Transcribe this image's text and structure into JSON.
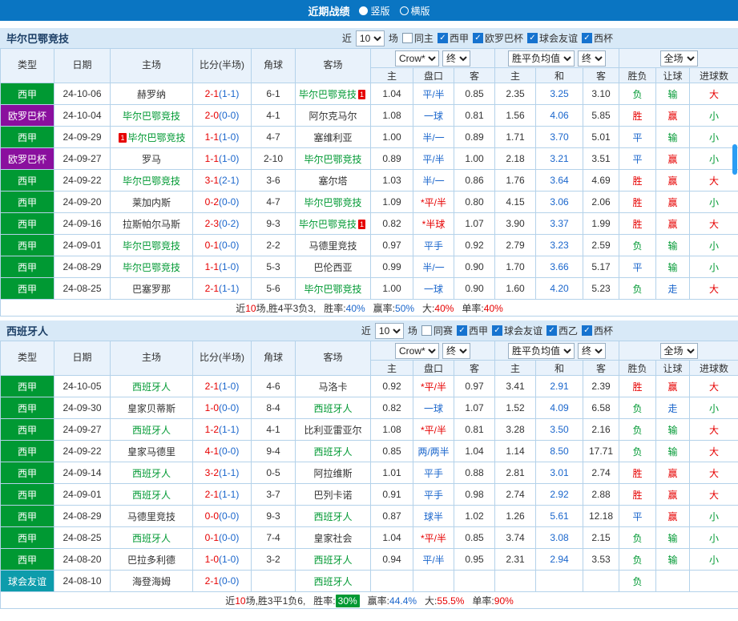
{
  "topbar": {
    "title": "近期战绩",
    "options": [
      {
        "label": "竖版",
        "selected": true
      },
      {
        "label": "横版",
        "selected": false
      }
    ]
  },
  "filter_text": {
    "near": "近",
    "games": "场"
  },
  "selects": {
    "company": "Crow*",
    "period": "终",
    "avg": "胜平负均值",
    "scope": "全场"
  },
  "columns": {
    "type": "类型",
    "date": "日期",
    "home": "主场",
    "score": "比分(半场)",
    "corner": "角球",
    "away": "客场",
    "o_home": "主",
    "o_line": "盘口",
    "o_away": "客",
    "e_home": "主",
    "e_draw": "和",
    "e_away": "客",
    "result": "胜负",
    "handicap": "让球",
    "goals": "进球数"
  },
  "type_colors": {
    "西甲": "#009933",
    "欧罗巴杯": "#8a0f9e",
    "球会友谊": "#0d9cab"
  },
  "sections": [
    {
      "team": "毕尔巴鄂竞技",
      "count": "10",
      "checkboxes": [
        {
          "label": "同主",
          "checked": false
        },
        {
          "label": "西甲",
          "checked": true
        },
        {
          "label": "欧罗巴杯",
          "checked": true
        },
        {
          "label": "球会友谊",
          "checked": true
        },
        {
          "label": "西杯",
          "checked": true
        }
      ],
      "rows": [
        {
          "type": "西甲",
          "date": "24-10-06",
          "home": "赫罗纳",
          "score": "2-1",
          "half": "(1-1)",
          "corner": "6-1",
          "away": "毕尔巴鄂竞技",
          "away_focus": true,
          "away_card": 1,
          "crow_home": "1.04",
          "line": "平/半",
          "crow_away": "0.85",
          "avg_home": "2.35",
          "avg_draw": "3.25",
          "avg_away": "3.10",
          "result": "负",
          "handicap": "输",
          "goals": "大"
        },
        {
          "type": "欧罗巴杯",
          "date": "24-10-04",
          "home": "毕尔巴鄂竞技",
          "home_focus": true,
          "score": "2-0",
          "half": "(0-0)",
          "corner": "4-1",
          "away": "阿尔克马尔",
          "crow_home": "1.08",
          "line": "一球",
          "crow_away": "0.81",
          "avg_home": "1.56",
          "avg_draw": "4.06",
          "avg_away": "5.85",
          "result": "胜",
          "handicap": "赢",
          "goals": "小"
        },
        {
          "type": "西甲",
          "date": "24-09-29",
          "home": "毕尔巴鄂竞技",
          "home_focus": true,
          "home_card": 1,
          "card_left": true,
          "score": "1-1",
          "half": "(1-0)",
          "corner": "4-7",
          "away": "塞维利亚",
          "crow_home": "1.00",
          "line": "半/一",
          "crow_away": "0.89",
          "avg_home": "1.71",
          "avg_draw": "3.70",
          "avg_away": "5.01",
          "result": "平",
          "handicap": "输",
          "goals": "小"
        },
        {
          "type": "欧罗巴杯",
          "date": "24-09-27",
          "home": "罗马",
          "score": "1-1",
          "half": "(1-0)",
          "corner": "2-10",
          "away": "毕尔巴鄂竞技",
          "away_focus": true,
          "crow_home": "0.89",
          "line": "平/半",
          "crow_away": "1.00",
          "avg_home": "2.18",
          "avg_draw": "3.21",
          "avg_away": "3.51",
          "result": "平",
          "handicap": "赢",
          "goals": "小"
        },
        {
          "type": "西甲",
          "date": "24-09-22",
          "home": "毕尔巴鄂竞技",
          "home_focus": true,
          "score": "3-1",
          "half": "(2-1)",
          "corner": "3-6",
          "away": "塞尔塔",
          "crow_home": "1.03",
          "line": "半/一",
          "crow_away": "0.86",
          "avg_home": "1.76",
          "avg_draw": "3.64",
          "avg_away": "4.69",
          "result": "胜",
          "handicap": "赢",
          "goals": "大"
        },
        {
          "type": "西甲",
          "date": "24-09-20",
          "home": "莱加内斯",
          "score": "0-2",
          "half": "(0-0)",
          "corner": "4-7",
          "away": "毕尔巴鄂竞技",
          "away_focus": true,
          "crow_home": "1.09",
          "line": "*平/半",
          "crow_away": "0.80",
          "avg_home": "4.15",
          "avg_draw": "3.06",
          "avg_away": "2.06",
          "result": "胜",
          "handicap": "赢",
          "goals": "小"
        },
        {
          "type": "西甲",
          "date": "24-09-16",
          "home": "拉斯帕尔马斯",
          "score": "2-3",
          "half": "(0-2)",
          "corner": "9-3",
          "away": "毕尔巴鄂竞技",
          "away_focus": true,
          "away_card": 1,
          "crow_home": "0.82",
          "line": "*半球",
          "crow_away": "1.07",
          "avg_home": "3.90",
          "avg_draw": "3.37",
          "avg_away": "1.99",
          "result": "胜",
          "handicap": "赢",
          "goals": "大"
        },
        {
          "type": "西甲",
          "date": "24-09-01",
          "home": "毕尔巴鄂竞技",
          "home_focus": true,
          "score": "0-1",
          "half": "(0-0)",
          "corner": "2-2",
          "away": "马德里竞技",
          "crow_home": "0.97",
          "line": "平手",
          "crow_away": "0.92",
          "avg_home": "2.79",
          "avg_draw": "3.23",
          "avg_away": "2.59",
          "result": "负",
          "handicap": "输",
          "goals": "小"
        },
        {
          "type": "西甲",
          "date": "24-08-29",
          "home": "毕尔巴鄂竞技",
          "home_focus": true,
          "score": "1-1",
          "half": "(1-0)",
          "corner": "5-3",
          "away": "巴伦西亚",
          "crow_home": "0.99",
          "line": "半/一",
          "crow_away": "0.90",
          "avg_home": "1.70",
          "avg_draw": "3.66",
          "avg_away": "5.17",
          "result": "平",
          "handicap": "输",
          "goals": "小"
        },
        {
          "type": "西甲",
          "date": "24-08-25",
          "home": "巴塞罗那",
          "score": "2-1",
          "half": "(1-1)",
          "corner": "5-6",
          "away": "毕尔巴鄂竞技",
          "away_focus": true,
          "crow_home": "1.00",
          "line": "一球",
          "crow_away": "0.90",
          "avg_home": "1.60",
          "avg_draw": "4.20",
          "avg_away": "5.23",
          "result": "负",
          "handicap": "走",
          "goals": "大"
        }
      ],
      "summary": {
        "lead": "近",
        "count": "10",
        "tail": "场,胜4平3负3,",
        "win_label": "胜率:",
        "win": "40%",
        "win_badge": false,
        "ah_label": "赢率:",
        "ah": "50%",
        "big_label": "大:",
        "big": "40%",
        "odd_label": "单率:",
        "odd": "40%"
      }
    },
    {
      "team": "西班牙人",
      "count": "10",
      "checkboxes": [
        {
          "label": "同赛",
          "checked": false
        },
        {
          "label": "西甲",
          "checked": true
        },
        {
          "label": "球会友谊",
          "checked": true
        },
        {
          "label": "西乙",
          "checked": true
        },
        {
          "label": "西杯",
          "checked": true
        }
      ],
      "rows": [
        {
          "type": "西甲",
          "date": "24-10-05",
          "home": "西班牙人",
          "home_focus": true,
          "score": "2-1",
          "half": "(1-0)",
          "corner": "4-6",
          "away": "马洛卡",
          "crow_home": "0.92",
          "line": "*平/半",
          "crow_away": "0.97",
          "avg_home": "3.41",
          "avg_draw": "2.91",
          "avg_away": "2.39",
          "result": "胜",
          "handicap": "赢",
          "goals": "大"
        },
        {
          "type": "西甲",
          "date": "24-09-30",
          "home": "皇家贝蒂斯",
          "score": "1-0",
          "half": "(0-0)",
          "corner": "8-4",
          "away": "西班牙人",
          "away_focus": true,
          "crow_home": "0.82",
          "line": "一球",
          "crow_away": "1.07",
          "avg_home": "1.52",
          "avg_draw": "4.09",
          "avg_away": "6.58",
          "result": "负",
          "handicap": "走",
          "goals": "小"
        },
        {
          "type": "西甲",
          "date": "24-09-27",
          "home": "西班牙人",
          "home_focus": true,
          "score": "1-2",
          "half": "(1-1)",
          "corner": "4-1",
          "away": "比利亚雷亚尔",
          "crow_home": "1.08",
          "line": "*平/半",
          "crow_away": "0.81",
          "avg_home": "3.28",
          "avg_draw": "3.50",
          "avg_away": "2.16",
          "result": "负",
          "handicap": "输",
          "goals": "大"
        },
        {
          "type": "西甲",
          "date": "24-09-22",
          "home": "皇家马德里",
          "score": "4-1",
          "half": "(0-0)",
          "corner": "9-4",
          "away": "西班牙人",
          "away_focus": true,
          "crow_home": "0.85",
          "line": "两/两半",
          "crow_away": "1.04",
          "avg_home": "1.14",
          "avg_draw": "8.50",
          "avg_away": "17.71",
          "result": "负",
          "handicap": "输",
          "goals": "大"
        },
        {
          "type": "西甲",
          "date": "24-09-14",
          "home": "西班牙人",
          "home_focus": true,
          "score": "3-2",
          "half": "(1-1)",
          "corner": "0-5",
          "away": "阿拉维斯",
          "crow_home": "1.01",
          "line": "平手",
          "crow_away": "0.88",
          "avg_home": "2.81",
          "avg_draw": "3.01",
          "avg_away": "2.74",
          "result": "胜",
          "handicap": "赢",
          "goals": "大"
        },
        {
          "type": "西甲",
          "date": "24-09-01",
          "home": "西班牙人",
          "home_focus": true,
          "score": "2-1",
          "half": "(1-1)",
          "corner": "3-7",
          "away": "巴列卡诺",
          "crow_home": "0.91",
          "line": "平手",
          "crow_away": "0.98",
          "avg_home": "2.74",
          "avg_draw": "2.92",
          "avg_away": "2.88",
          "result": "胜",
          "handicap": "赢",
          "goals": "大"
        },
        {
          "type": "西甲",
          "date": "24-08-29",
          "home": "马德里竞技",
          "score": "0-0",
          "half": "(0-0)",
          "corner": "9-3",
          "away": "西班牙人",
          "away_focus": true,
          "crow_home": "0.87",
          "line": "球半",
          "crow_away": "1.02",
          "avg_home": "1.26",
          "avg_draw": "5.61",
          "avg_away": "12.18",
          "result": "平",
          "handicap": "赢",
          "goals": "小"
        },
        {
          "type": "西甲",
          "date": "24-08-25",
          "home": "西班牙人",
          "home_focus": true,
          "score": "0-1",
          "half": "(0-0)",
          "corner": "7-4",
          "away": "皇家社会",
          "crow_home": "1.04",
          "line": "*平/半",
          "crow_away": "0.85",
          "avg_home": "3.74",
          "avg_draw": "3.08",
          "avg_away": "2.15",
          "result": "负",
          "handicap": "输",
          "goals": "小"
        },
        {
          "type": "西甲",
          "date": "24-08-20",
          "home": "巴拉多利德",
          "score": "1-0",
          "half": "(1-0)",
          "corner": "3-2",
          "away": "西班牙人",
          "away_focus": true,
          "crow_home": "0.94",
          "line": "平/半",
          "crow_away": "0.95",
          "avg_home": "2.31",
          "avg_draw": "2.94",
          "avg_away": "3.53",
          "result": "负",
          "handicap": "输",
          "goals": "小"
        },
        {
          "type": "球会友谊",
          "date": "24-08-10",
          "home": "海登海姆",
          "score": "2-1",
          "half": "(0-0)",
          "corner": "",
          "away": "西班牙人",
          "away_focus": true,
          "crow_home": "",
          "line": "",
          "crow_away": "",
          "avg_home": "",
          "avg_draw": "",
          "avg_away": "",
          "result": "负",
          "handicap": "",
          "goals": ""
        }
      ],
      "summary": {
        "lead": "近",
        "count": "10",
        "tail": "场,胜3平1负6,",
        "win_label": "胜率:",
        "win": "30%",
        "win_badge": true,
        "ah_label": "赢率:",
        "ah": "44.4%",
        "big_label": "大:",
        "big": "55.5%",
        "odd_label": "单率:",
        "odd": "90%"
      }
    }
  ]
}
